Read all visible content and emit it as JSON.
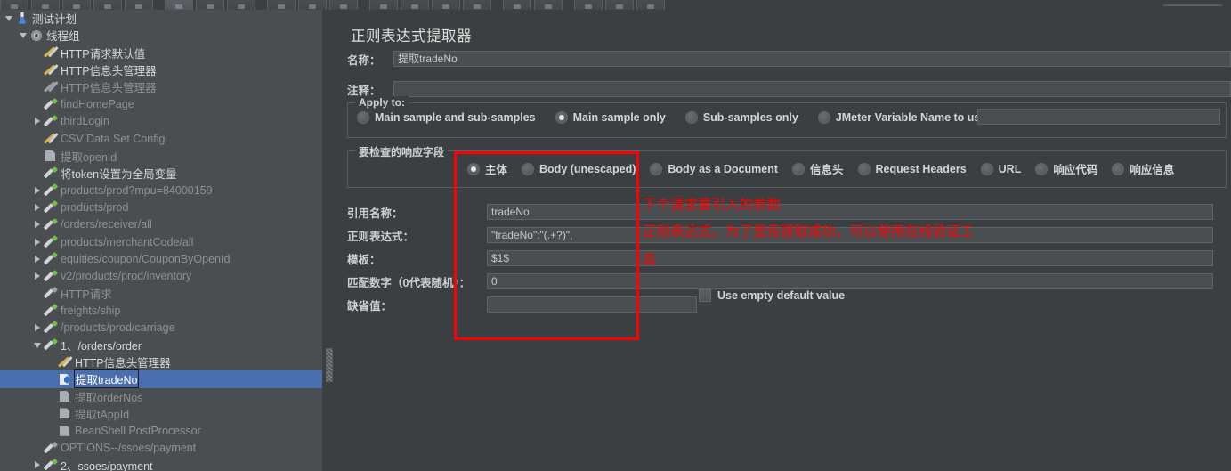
{
  "toolbar": {
    "buttons": [
      {
        "name": "new",
        "selected": false
      },
      {
        "name": "templates",
        "selected": false
      },
      {
        "name": "open",
        "selected": false
      },
      {
        "name": "save",
        "selected": false
      },
      {
        "name": "cut",
        "selected": false
      },
      {
        "name": "copy",
        "selected": true
      },
      {
        "name": "paste",
        "selected": false
      },
      {
        "name": "expand-all",
        "selected": false
      },
      {
        "name": "collapse-all",
        "selected": false
      },
      {
        "name": "toggle",
        "selected": false
      },
      {
        "name": "start",
        "selected": false
      },
      {
        "name": "start-no-pause",
        "selected": false
      },
      {
        "name": "stop",
        "selected": false
      },
      {
        "name": "shutdown",
        "selected": false
      },
      {
        "name": "clear",
        "selected": false
      },
      {
        "name": "clear-all",
        "selected": false
      },
      {
        "name": "search",
        "selected": false
      },
      {
        "name": "search-reset",
        "selected": false
      },
      {
        "name": "function-helper",
        "selected": false
      },
      {
        "name": "help",
        "selected": false
      }
    ]
  },
  "tree": {
    "items": [
      {
        "label": "测试计划",
        "indent": 0,
        "toggle": "open",
        "icon": "flask",
        "muted": false,
        "selected": false
      },
      {
        "label": "线程组",
        "indent": 1,
        "toggle": "open",
        "icon": "gear",
        "muted": false,
        "selected": false
      },
      {
        "label": "HTTP请求默认值",
        "indent": 2,
        "toggle": "none",
        "icon": "wrench",
        "muted": false,
        "selected": false
      },
      {
        "label": "HTTP信息头管理器",
        "indent": 2,
        "toggle": "none",
        "icon": "wrench",
        "muted": false,
        "selected": false
      },
      {
        "label": "HTTP信息头管理器",
        "indent": 2,
        "toggle": "none",
        "icon": "wrench-gray",
        "muted": true,
        "selected": false
      },
      {
        "label": "findHomePage",
        "indent": 2,
        "toggle": "none",
        "icon": "pipette",
        "muted": true,
        "selected": false
      },
      {
        "label": "thirdLogin",
        "indent": 2,
        "toggle": "closed",
        "icon": "pipette",
        "muted": true,
        "selected": false
      },
      {
        "label": "CSV Data Set Config",
        "indent": 2,
        "toggle": "none",
        "icon": "wrench",
        "muted": true,
        "selected": false
      },
      {
        "label": "提取openId",
        "indent": 2,
        "toggle": "none",
        "icon": "page",
        "muted": true,
        "selected": false
      },
      {
        "label": "将token设置为全局变量",
        "indent": 2,
        "toggle": "none",
        "icon": "pipette",
        "muted": false,
        "selected": false
      },
      {
        "label": "products/prod?mpu=84000159",
        "indent": 2,
        "toggle": "closed",
        "icon": "pipette",
        "muted": true,
        "selected": false
      },
      {
        "label": "products/prod",
        "indent": 2,
        "toggle": "closed",
        "icon": "pipette",
        "muted": true,
        "selected": false
      },
      {
        "label": "/orders/receiver/all",
        "indent": 2,
        "toggle": "closed",
        "icon": "pipette",
        "muted": true,
        "selected": false
      },
      {
        "label": "products/merchantCode/all",
        "indent": 2,
        "toggle": "closed",
        "icon": "pipette",
        "muted": true,
        "selected": false
      },
      {
        "label": "equities/coupon/CouponByOpenId",
        "indent": 2,
        "toggle": "closed",
        "icon": "pipette",
        "muted": true,
        "selected": false
      },
      {
        "label": "v2/products/prod/inventory",
        "indent": 2,
        "toggle": "closed",
        "icon": "pipette",
        "muted": true,
        "selected": false
      },
      {
        "label": "HTTP请求",
        "indent": 2,
        "toggle": "none",
        "icon": "pipette-gray",
        "muted": true,
        "selected": false
      },
      {
        "label": "freights/ship",
        "indent": 2,
        "toggle": "none",
        "icon": "pipette",
        "muted": true,
        "selected": false
      },
      {
        "label": "/products/prod/carriage",
        "indent": 2,
        "toggle": "closed",
        "icon": "pipette",
        "muted": true,
        "selected": false
      },
      {
        "label": "1、/orders/order",
        "indent": 2,
        "toggle": "open",
        "icon": "pipette",
        "muted": false,
        "selected": false
      },
      {
        "label": "HTTP信息头管理器",
        "indent": 3,
        "toggle": "none",
        "icon": "wrench",
        "muted": false,
        "selected": false
      },
      {
        "label": "提取tradeNo",
        "indent": 3,
        "toggle": "none",
        "icon": "page-white",
        "muted": false,
        "selected": true
      },
      {
        "label": "提取orderNos",
        "indent": 3,
        "toggle": "none",
        "icon": "page",
        "muted": true,
        "selected": false
      },
      {
        "label": "提取tAppId",
        "indent": 3,
        "toggle": "none",
        "icon": "page",
        "muted": true,
        "selected": false
      },
      {
        "label": "BeanShell PostProcessor",
        "indent": 3,
        "toggle": "none",
        "icon": "page",
        "muted": true,
        "selected": false
      },
      {
        "label": "OPTIONS--/ssoes/payment",
        "indent": 2,
        "toggle": "none",
        "icon": "pipette-gray",
        "muted": true,
        "selected": false
      },
      {
        "label": "2、ssoes/payment",
        "indent": 2,
        "toggle": "closed",
        "icon": "pipette",
        "muted": false,
        "selected": false
      }
    ]
  },
  "panel": {
    "title": "正则表达式提取器",
    "name_label": "名称：",
    "name_value": "提取tradeNo",
    "comment_label": "注释：",
    "comment_value": "",
    "apply_to": {
      "title": "Apply to:",
      "options": [
        {
          "label": "Main sample and sub-samples",
          "selected": false
        },
        {
          "label": "Main sample only",
          "selected": true
        },
        {
          "label": "Sub-samples only",
          "selected": false
        },
        {
          "label": "JMeter Variable Name to use",
          "selected": false
        }
      ],
      "variable_value": ""
    },
    "field_to_check": {
      "title": "要检查的响应字段",
      "options": [
        {
          "label": "主体",
          "selected": true
        },
        {
          "label": "Body (unescaped)",
          "selected": false
        },
        {
          "label": "Body as a Document",
          "selected": false
        },
        {
          "label": "信息头",
          "selected": false
        },
        {
          "label": "Request Headers",
          "selected": false
        },
        {
          "label": "URL",
          "selected": false
        },
        {
          "label": "响应代码",
          "selected": false
        },
        {
          "label": "响应信息",
          "selected": false
        }
      ]
    },
    "fields": [
      {
        "label": "引用名称：",
        "value": "tradeNo"
      },
      {
        "label": "正则表达式：",
        "value": "\"tradeNo\":\"(.+?)\","
      },
      {
        "label": "模板：",
        "value": "$1$"
      },
      {
        "label": "匹配数字（0代表随机）：",
        "value": "0"
      },
      {
        "label": "缺省值：",
        "value": ""
      }
    ],
    "use_empty_default_label": "Use empty default value",
    "use_empty_default_checked": false
  },
  "annotations": {
    "lines": [
      "下个请求要引入的参数",
      "正则表达式，为了是否提取成功，可以使用在线验证工",
      "具"
    ],
    "color": "#ff0000"
  }
}
